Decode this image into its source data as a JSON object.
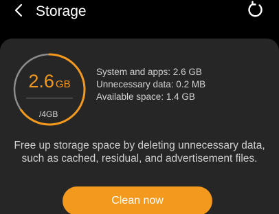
{
  "header": {
    "title": "Storage"
  },
  "icons": {
    "back": "chevron-left-icon",
    "refresh": "refresh-icon"
  },
  "storage": {
    "used_value": "2.6",
    "used_unit": "GB",
    "total": "/4GB",
    "used_fraction": 0.65
  },
  "stats": [
    "System and apps: 2.6 GB",
    "Unnecessary data: 0.2 MB",
    "Available space: 1.4 GB"
  ],
  "description": "Free up storage space by deleting unnecessary data, such as cached, residual, and advertisement files.",
  "actions": {
    "clean_label": "Clean now"
  },
  "colors": {
    "accent": "#f39a1e",
    "ring_track": "#8c8c8c",
    "card": "#262626"
  }
}
